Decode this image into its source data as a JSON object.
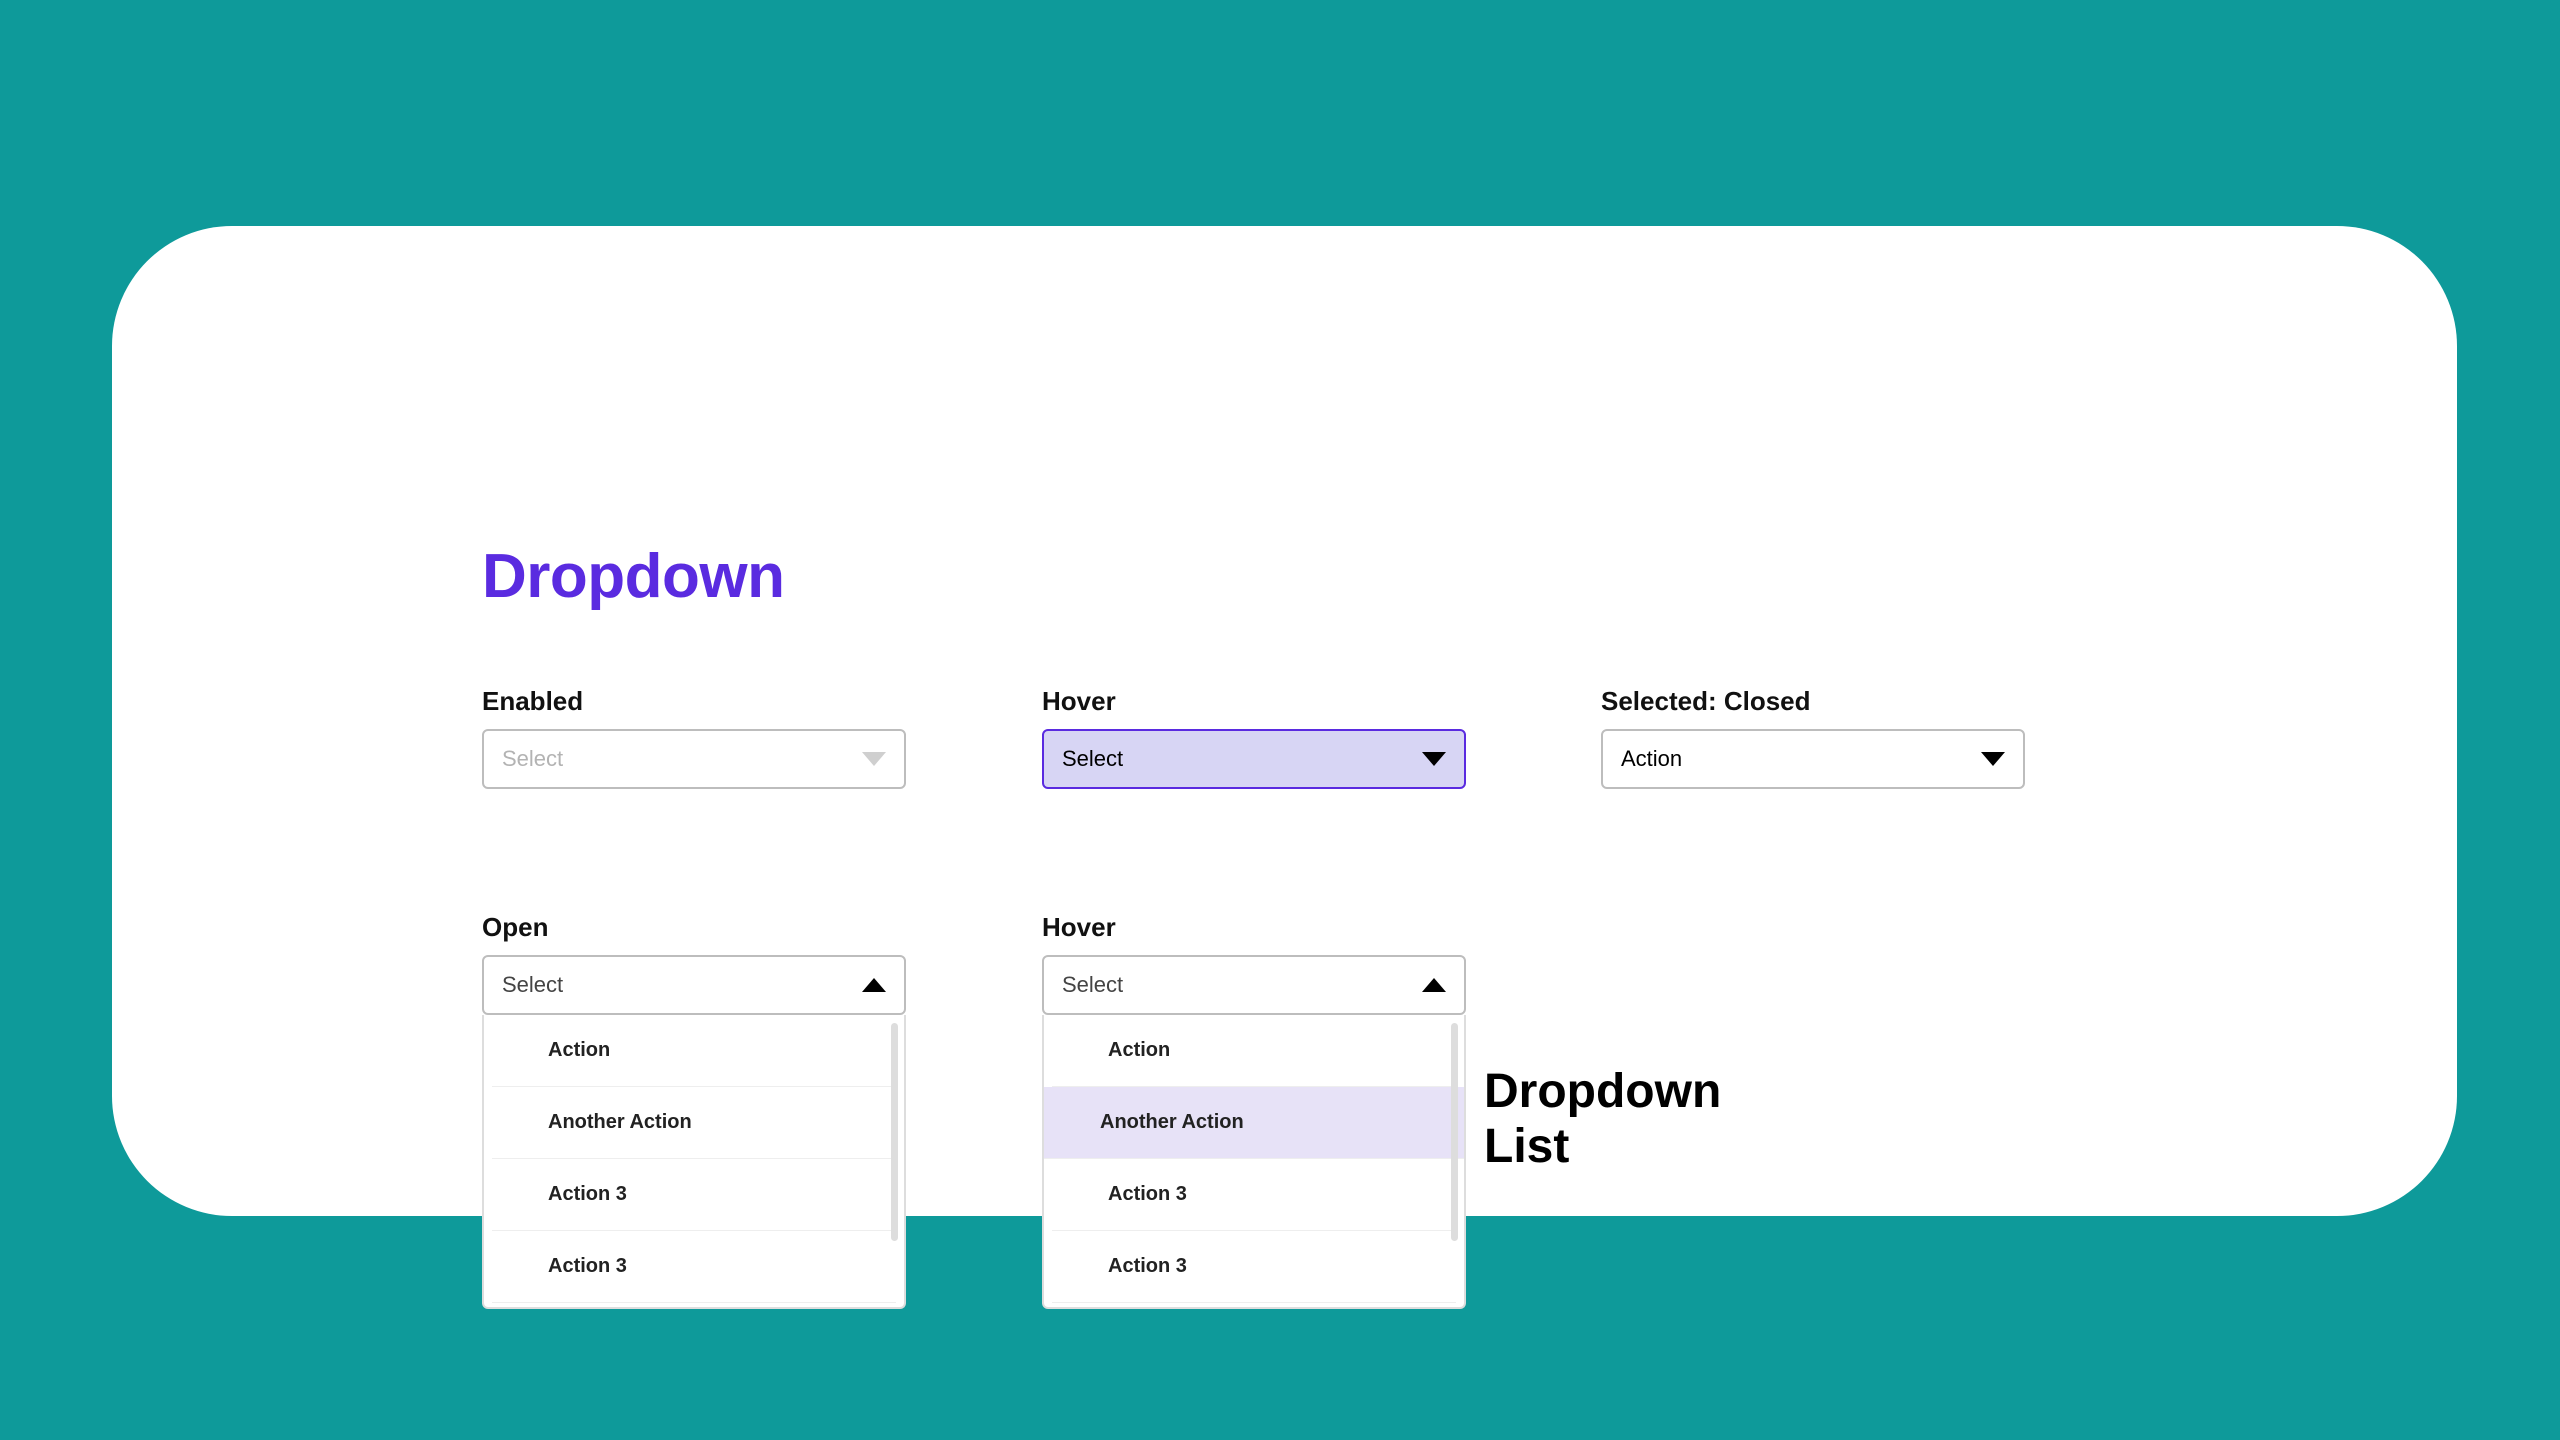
{
  "title": "Dropdown",
  "colors": {
    "background": "#0e9a9a",
    "accent": "#5a2be0",
    "hover_fill": "#d7d5f4",
    "item_hover_fill": "#e7e2f7"
  },
  "states": {
    "enabled": {
      "label": "Enabled",
      "placeholder": "Select"
    },
    "hover_closed": {
      "label": "Hover",
      "placeholder": "Select"
    },
    "selected_closed": {
      "label": "Selected: Closed",
      "value": "Action"
    },
    "open": {
      "label": "Open",
      "placeholder": "Select"
    },
    "hover_open": {
      "label": "Hover",
      "placeholder": "Select"
    }
  },
  "options": [
    "Action",
    "Another Action",
    "Action 3",
    "Action 3"
  ],
  "hover_open_hovered_index": 1,
  "annotation": "Dropdown\nList"
}
